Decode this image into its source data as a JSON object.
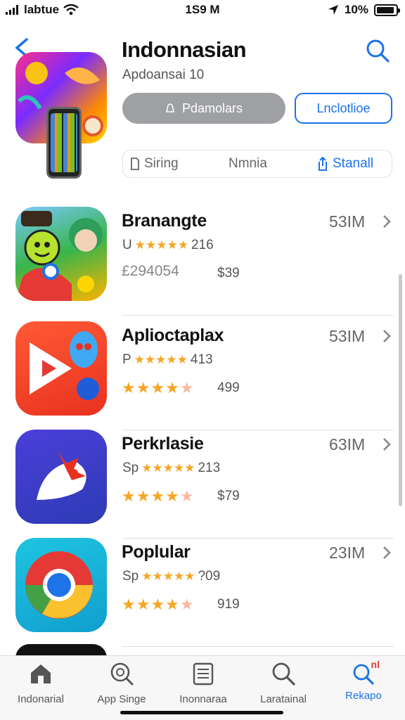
{
  "status_bar": {
    "carrier": "labtue",
    "time": "1S9 M",
    "battery": "10%"
  },
  "header": {
    "title": "Indonnasian",
    "subtitle": "Apdoansai 10",
    "primary_button": "Pdamolars",
    "secondary_button": "Lnclotlioe"
  },
  "segments": [
    {
      "label": "Siring",
      "active": false
    },
    {
      "label": "Nmnia",
      "active": false
    },
    {
      "label": "Stanall",
      "active": true
    }
  ],
  "apps": [
    {
      "name": "Branangte",
      "size": "53IM",
      "sub_prefix": "U",
      "rating_text": "216",
      "tag": "£294054",
      "price": "$39"
    },
    {
      "name": "Aplioctaplax",
      "size": "53IM",
      "sub_prefix": "P",
      "rating_text": "413",
      "price": "499"
    },
    {
      "name": "Perkrlasie",
      "size": "63IM",
      "sub_prefix": "Sp",
      "rating_text": "213",
      "price": "$79"
    },
    {
      "name": "Poplular",
      "size": "23IM",
      "sub_prefix": "Sp",
      "rating_text": "?09",
      "price": "919"
    }
  ],
  "tabs": [
    {
      "label": "Indonarial",
      "icon": "home-icon",
      "active": false
    },
    {
      "label": "App Singe",
      "icon": "search-circle-icon",
      "active": false
    },
    {
      "label": "Inonnaraa",
      "icon": "list-icon",
      "active": false
    },
    {
      "label": "Laratainal",
      "icon": "search-icon",
      "active": false
    },
    {
      "label": "Rekapo",
      "icon": "search-badge-icon",
      "active": true,
      "badge": "nl"
    }
  ],
  "colors": {
    "accent": "#1a73e8",
    "star": "#f5a623",
    "gray_button": "#9ea0a3"
  }
}
